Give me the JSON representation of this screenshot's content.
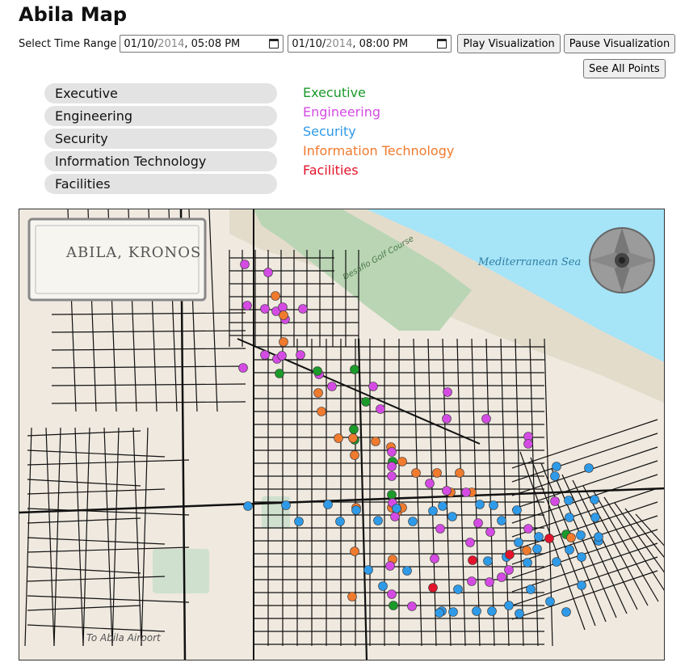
{
  "page": {
    "title": "Abila Map"
  },
  "controls": {
    "time_range_label": "Select Time Range",
    "start": {
      "month": "01",
      "day": "10",
      "year": "2014",
      "time": ", 05:08 PM"
    },
    "end": {
      "month": "01",
      "day": "10",
      "year": "2014",
      "time": ", 08:00 PM"
    },
    "play_label": "Play Visualization",
    "pause_label": "Pause Visualization",
    "see_all_label": "See All Points"
  },
  "departments": [
    "Executive",
    "Engineering",
    "Security",
    "Information Technology",
    "Facilities"
  ],
  "legend": [
    {
      "label": "Executive",
      "color": "#1b9a2a"
    },
    {
      "label": "Engineering",
      "color": "#d44be3"
    },
    {
      "label": "Security",
      "color": "#2f9ae8"
    },
    {
      "label": "Information Technology",
      "color": "#f07a2e"
    },
    {
      "label": "Facilities",
      "color": "#e2132a"
    }
  ],
  "map": {
    "city_label": "ABILA, KRONOS",
    "sea_label": "Mediterranean Sea",
    "airport_label": "To Abila Airport",
    "golf_label": "Desafio Golf Course",
    "colors": {
      "land": "#efe9df",
      "sea": "#a6e4f7",
      "park": "#cfe0cf",
      "street": "#111111",
      "beach": "#e3dccb"
    }
  }
}
